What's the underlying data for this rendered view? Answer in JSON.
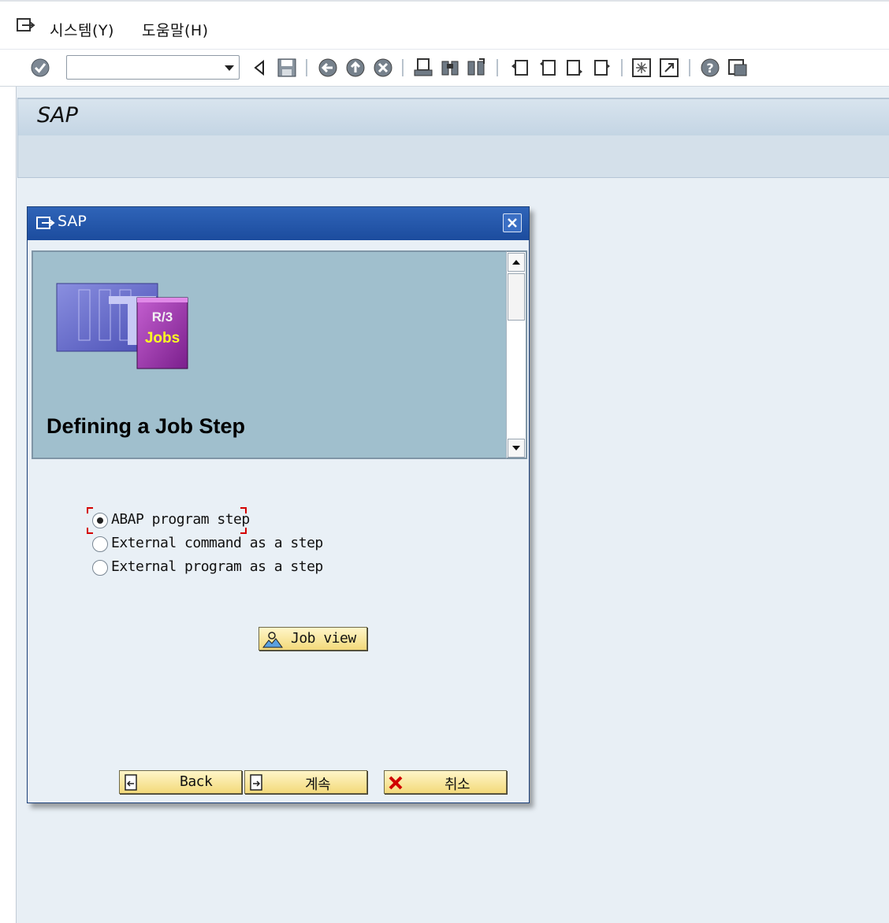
{
  "menu": {
    "items": [
      "시스템(Y)",
      "도움말(H)"
    ]
  },
  "toolbar": {
    "icons": [
      "enter-icon",
      "command-field",
      "back-icon",
      "save-icon",
      "back-circle-icon",
      "exit-icon",
      "cancel-icon",
      "print-icon",
      "find-icon",
      "find-next-icon",
      "first-page-icon",
      "previous-page-icon",
      "next-page-icon",
      "last-page-icon",
      "create-session-icon",
      "shortcut-icon",
      "help-icon",
      "customize-layout-icon"
    ]
  },
  "screen": {
    "title": "SAP"
  },
  "dialog": {
    "title": "SAP",
    "banner": {
      "heading": "Defining a Job Step",
      "graphic_text": [
        "R/3",
        "Jobs"
      ]
    },
    "options": [
      {
        "label": "ABAP program step",
        "selected": true
      },
      {
        "label": "External command as a step",
        "selected": false
      },
      {
        "label": "External program as a step",
        "selected": false
      }
    ],
    "job_view_label": "Job view",
    "buttons": {
      "back": "Back",
      "continue": "계속",
      "cancel": "취소"
    }
  },
  "colors": {
    "dialog_title": "#1c4c9e",
    "banner": "#a0bfcd",
    "button": "#f3d97a",
    "background": "#e8eff5"
  }
}
